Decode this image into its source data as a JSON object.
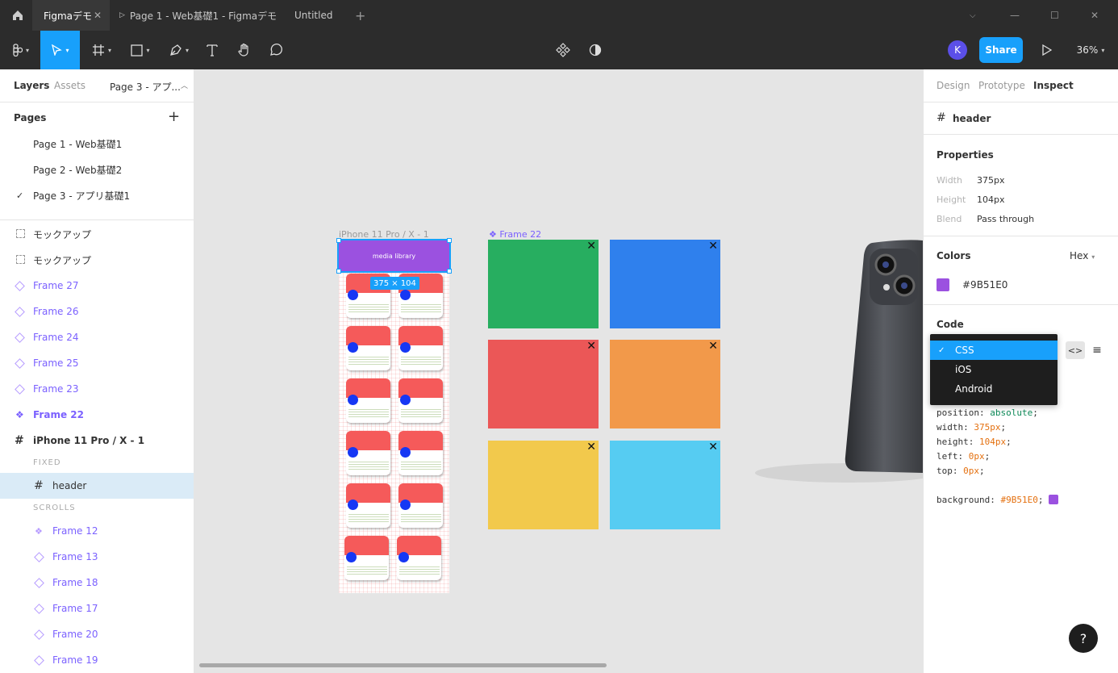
{
  "tabs": [
    {
      "label": "Figmaデモ"
    },
    {
      "label": "Page 1 - Web基礎1 - Figmaデモ"
    },
    {
      "label": "Untitled"
    }
  ],
  "toolbar": {
    "avatar": "K",
    "share": "Share",
    "zoom": "36%"
  },
  "left": {
    "tab_layers": "Layers",
    "tab_assets": "Assets",
    "page_select": "Page 3 - アプ...",
    "pages_title": "Pages",
    "pages": [
      {
        "label": "Page 1 - Web基礎1"
      },
      {
        "label": "Page 2 - Web基礎2"
      },
      {
        "label": "Page 3 - アプリ基礎1"
      }
    ],
    "layers": [
      {
        "label": "モックアップ"
      },
      {
        "label": "モックアップ"
      },
      {
        "label": "Frame 27"
      },
      {
        "label": "Frame 26"
      },
      {
        "label": "Frame 24"
      },
      {
        "label": "Frame 25"
      },
      {
        "label": "Frame 23"
      },
      {
        "label": "Frame 22"
      },
      {
        "label": "iPhone 11 Pro / X - 1"
      }
    ],
    "fixed_label": "FIXED",
    "header_layer": "header",
    "scrolls_label": "SCROLLS",
    "children": [
      {
        "label": "Frame 12"
      },
      {
        "label": "Frame 13"
      },
      {
        "label": "Frame 18"
      },
      {
        "label": "Frame 17"
      },
      {
        "label": "Frame 20"
      },
      {
        "label": "Frame 19"
      }
    ]
  },
  "canvas": {
    "phone_title": "iPhone 11 Pro / X - 1",
    "header_text": "media library",
    "size_badge": "375 × 104",
    "frame22_title": "Frame 22",
    "squares": [
      {
        "color": "#27ae60"
      },
      {
        "color": "#2f80ed"
      },
      {
        "color": "#eb5757"
      },
      {
        "color": "#f2994a"
      },
      {
        "color": "#f2c94c"
      },
      {
        "color": "#56ccf2"
      }
    ],
    "close_glyph": "✕"
  },
  "right": {
    "tab_design": "Design",
    "tab_prototype": "Prototype",
    "tab_inspect": "Inspect",
    "layer_name": "header",
    "properties_title": "Properties",
    "props": [
      {
        "k": "Width",
        "v": "375px"
      },
      {
        "k": "Height",
        "v": "104px"
      },
      {
        "k": "Blend",
        "v": "Pass through"
      }
    ],
    "colors_title": "Colors",
    "color_format": "Hex",
    "color_hex": "#9B51E0",
    "color_value": "#9B51E0",
    "code_title": "Code",
    "dropdown": [
      {
        "label": "CSS"
      },
      {
        "label": "iOS"
      },
      {
        "label": "Android"
      }
    ],
    "code": {
      "l1k": "position:",
      "l1v": "absolute",
      "l2k": "width:",
      "l2v": "375px",
      "l3k": "height:",
      "l3v": "104px",
      "l4k": "left:",
      "l4v": "0px",
      "l5k": "top:",
      "l5v": "0px",
      "l6k": "background:",
      "l6v": "#9B51E0"
    }
  },
  "help": "?"
}
